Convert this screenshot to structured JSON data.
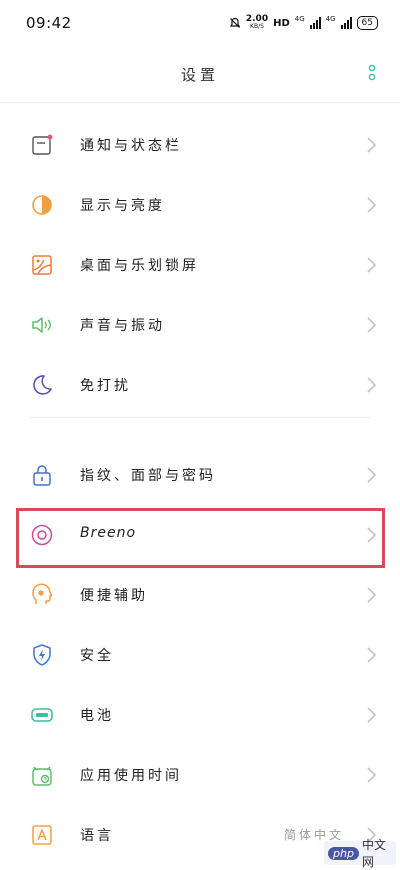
{
  "status_bar": {
    "time": "09:42",
    "net_speed": "2.00",
    "net_unit": "KB/S",
    "hd": "HD",
    "signal_1": "4G",
    "signal_2": "4G",
    "battery": "65"
  },
  "header": {
    "title": "设置"
  },
  "groups": [
    {
      "items": [
        {
          "label": "通知与状态栏",
          "icon": "notification-icon",
          "color": "#e05a72"
        },
        {
          "label": "显示与亮度",
          "icon": "brightness-icon",
          "color": "#f0a040"
        },
        {
          "label": "桌面与乐划锁屏",
          "icon": "wallpaper-icon",
          "color": "#f07a3c"
        },
        {
          "label": "声音与振动",
          "icon": "speaker-icon",
          "color": "#5bbf6a"
        },
        {
          "label": "免打扰",
          "icon": "moon-icon",
          "color": "#5a56b0"
        }
      ]
    },
    {
      "items": [
        {
          "label": "指纹、面部与密码",
          "icon": "lock-icon",
          "color": "#4a6fc8"
        },
        {
          "label": "Breeno",
          "icon": "breeno-icon",
          "color": "#c84aa0"
        },
        {
          "label": "便捷辅助",
          "icon": "assist-icon",
          "color": "#f0a040"
        },
        {
          "label": "安全",
          "icon": "shield-icon",
          "color": "#3b78d8"
        },
        {
          "label": "电池",
          "icon": "battery-icon",
          "color": "#3cc0a0"
        },
        {
          "label": "应用使用时间",
          "icon": "app-timer-icon",
          "color": "#5bbf6a"
        },
        {
          "label": "语言",
          "value": "简体中文",
          "icon": "language-icon",
          "color": "#f0a040"
        }
      ]
    }
  ],
  "watermark": {
    "brand": "php",
    "suffix": "中文网"
  }
}
